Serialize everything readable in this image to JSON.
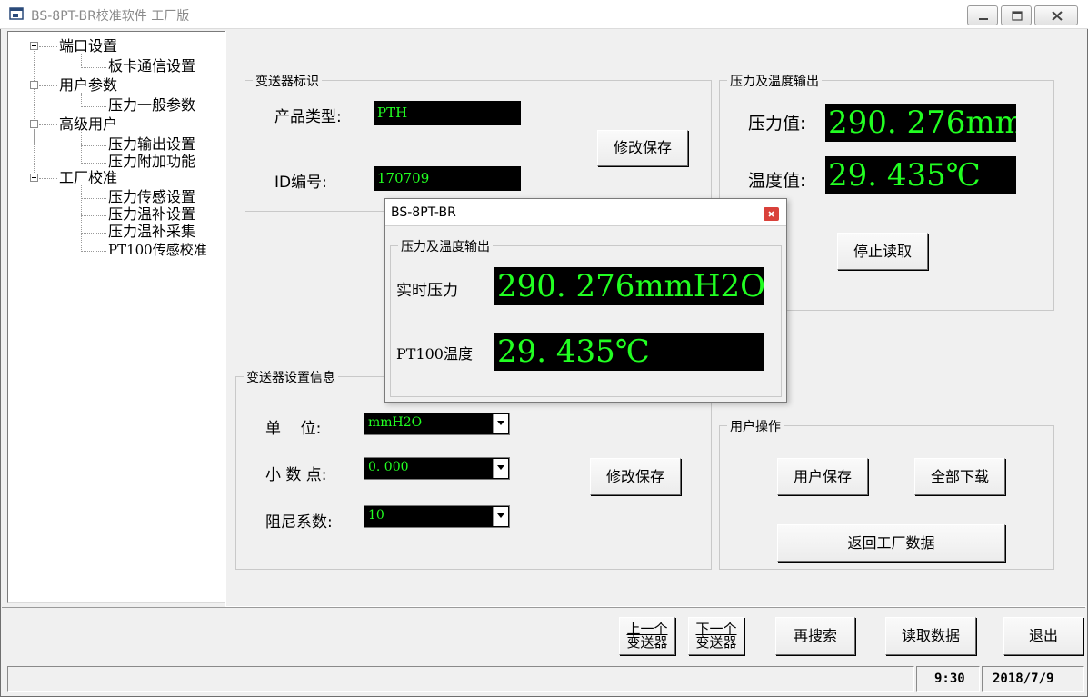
{
  "window": {
    "title": "BS-8PT-BR校准软件 工厂版"
  },
  "tree": {
    "items": [
      {
        "label": "端口设置",
        "children": [
          {
            "label": "板卡通信设置"
          }
        ]
      },
      {
        "label": "用户参数",
        "children": [
          {
            "label": "压力一般参数"
          }
        ]
      },
      {
        "label": "高级用户",
        "children": [
          {
            "label": "压力输出设置"
          },
          {
            "label": "压力附加功能"
          }
        ]
      },
      {
        "label": "工厂校准",
        "children": [
          {
            "label": "压力传感设置"
          },
          {
            "label": "压力温补设置"
          },
          {
            "label": "压力温补采集"
          },
          {
            "label": "PT100传感校准"
          }
        ]
      }
    ]
  },
  "transmitter_id": {
    "title": "变送器标识",
    "product_type_label": "产品类型:",
    "product_type_value": "PTH",
    "id_label": "ID编号:",
    "id_value": "170709",
    "save_button": "修改保存"
  },
  "output": {
    "title": "压力及温度输出",
    "pressure_label": "压力值:",
    "pressure_value": "290. 276mm",
    "temperature_label": "温度值:",
    "temperature_value": "29. 435℃",
    "stop_button": "停止读取"
  },
  "settings": {
    "title": "变送器设置信息",
    "unit_label": "单    位:",
    "unit_value": "mmH2O",
    "decimal_label": "小 数 点:",
    "decimal_value": "0. 000",
    "damping_label": "阻尼系数:",
    "damping_value": "10",
    "save_button": "修改保存"
  },
  "user_ops": {
    "title": "用户操作",
    "user_save": "用户保存",
    "download_all": "全部下载",
    "restore_factory": "返回工厂数据"
  },
  "popup": {
    "title": "BS-8PT-BR",
    "group_title": "压力及温度输出",
    "realtime_pressure_label": "实时压力",
    "realtime_pressure_value": "290. 276mmH2O",
    "pt100_label": "PT100温度",
    "pt100_value": "29. 435℃"
  },
  "toolbar": {
    "prev_line1": "上一个",
    "prev_line2": "变送器",
    "next_line1": "下一个",
    "next_line2": "变送器",
    "research": "再搜索",
    "read_data": "读取数据",
    "exit": "退出"
  },
  "status": {
    "time": "9:30",
    "date": "2018/7/9"
  },
  "colors": {
    "display_bg": "#000000",
    "display_text": "#22ff22",
    "popup_close": "#d9413a"
  }
}
